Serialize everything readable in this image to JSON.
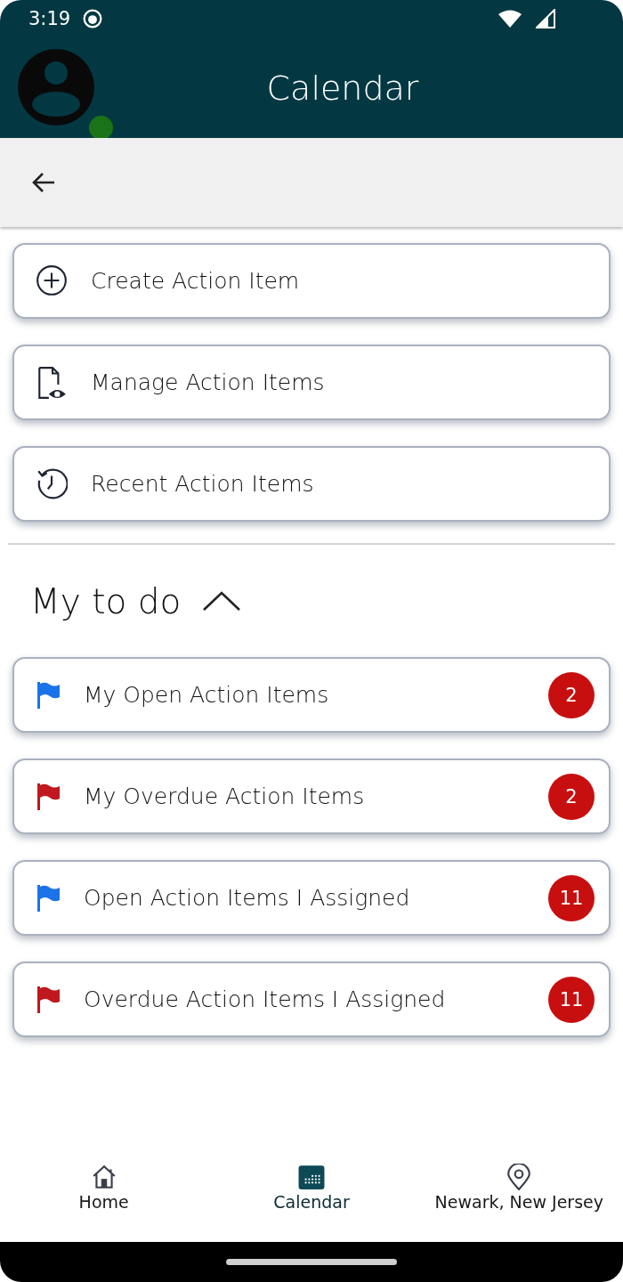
{
  "status_bar": {
    "time": "3:19"
  },
  "header": {
    "title": "Calendar",
    "online": true
  },
  "actions": [
    {
      "label": "Create Action Item",
      "kind": "create"
    },
    {
      "label": "Manage Action Items",
      "kind": "manage"
    },
    {
      "label": "Recent Action Items",
      "kind": "recent"
    }
  ],
  "todo": {
    "title": "My to do",
    "expanded": true,
    "items": [
      {
        "label": "My Open Action Items",
        "count": "2",
        "color": "#1a73e8"
      },
      {
        "label": "My Overdue Action Items",
        "count": "2",
        "color": "#c0181e"
      },
      {
        "label": "Open Action Items I Assigned",
        "count": "11",
        "color": "#1a73e8"
      },
      {
        "label": "Overdue Action Items I Assigned",
        "count": "11",
        "color": "#c0181e"
      }
    ]
  },
  "bottom_nav": [
    {
      "label": "Home",
      "kind": "home",
      "selected": false
    },
    {
      "label": "Calendar",
      "kind": "calendar",
      "selected": true
    },
    {
      "label": "Newark, New Jersey",
      "kind": "location",
      "selected": false
    }
  ]
}
